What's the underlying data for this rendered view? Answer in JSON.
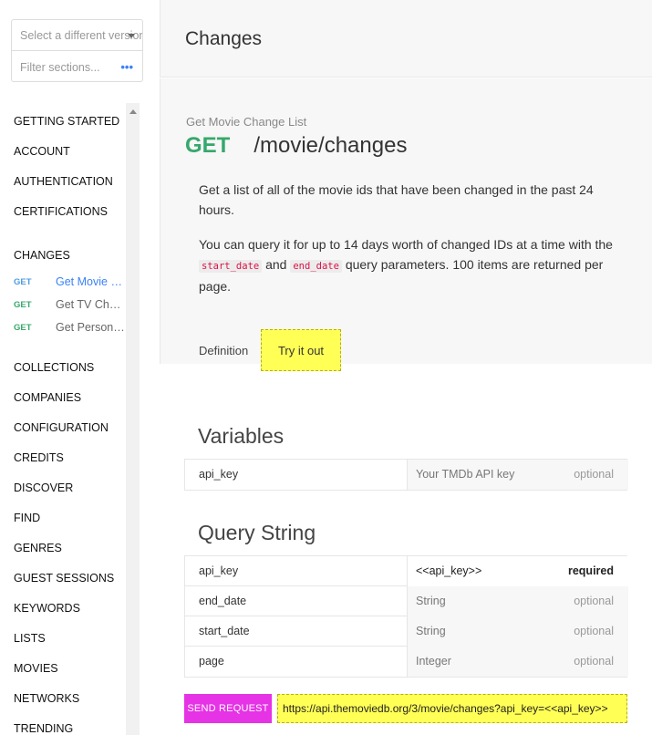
{
  "sidebar": {
    "version_select_placeholder": "Select a different version",
    "filter_placeholder": "Filter sections...",
    "filter_icon": "more-dots-icon",
    "items_top": [
      "GETTING STARTED",
      "ACCOUNT",
      "AUTHENTICATION",
      "CERTIFICATIONS"
    ],
    "section_changes": "CHANGES",
    "changes_items": [
      {
        "method": "GET",
        "label": "Get Movie Change List",
        "active": true
      },
      {
        "method": "GET",
        "label": "Get TV Change List",
        "active": false
      },
      {
        "method": "GET",
        "label": "Get Person Change List",
        "active": false
      }
    ],
    "items_bottom": [
      "COLLECTIONS",
      "COMPANIES",
      "CONFIGURATION",
      "CREDITS",
      "DISCOVER",
      "FIND",
      "GENRES",
      "GUEST SESSIONS",
      "KEYWORDS",
      "LISTS",
      "MOVIES",
      "NETWORKS",
      "TRENDING"
    ]
  },
  "header": {
    "title": "Changes"
  },
  "endpoint": {
    "kicker": "Get Movie Change List",
    "verb": "GET",
    "path": "/movie/changes",
    "desc1": "Get a list of all of the movie ids that have been changed in the past 24 hours.",
    "desc2_a": "You can query it for up to 14 days worth of changed IDs at a time with the ",
    "code1": "start_date",
    "desc2_b": " and ",
    "code2": "end_date",
    "desc2_c": " query parameters. 100 items are returned per page."
  },
  "tabs": {
    "definition": "Definition",
    "try": "Try it out"
  },
  "variables": {
    "title": "Variables",
    "rows": [
      {
        "name": "api_key",
        "value": "Your TMDb API key",
        "req": "optional"
      }
    ]
  },
  "query": {
    "title": "Query String",
    "rows": [
      {
        "name": "api_key",
        "value": "<<api_key>>",
        "req": "required"
      },
      {
        "name": "end_date",
        "value": "String",
        "req": "optional"
      },
      {
        "name": "start_date",
        "value": "String",
        "req": "optional"
      },
      {
        "name": "page",
        "value": "Integer",
        "req": "optional"
      }
    ]
  },
  "request": {
    "send_label": "SEND REQUEST",
    "url": "https://api.themoviedb.org/3/movie/changes?api_key=<<api_key>>"
  },
  "colors": {
    "get_green": "#36a86c",
    "active_blue": "#3b82f6",
    "send_magenta": "#e533e5",
    "highlight_yellow": "#ffff55"
  }
}
